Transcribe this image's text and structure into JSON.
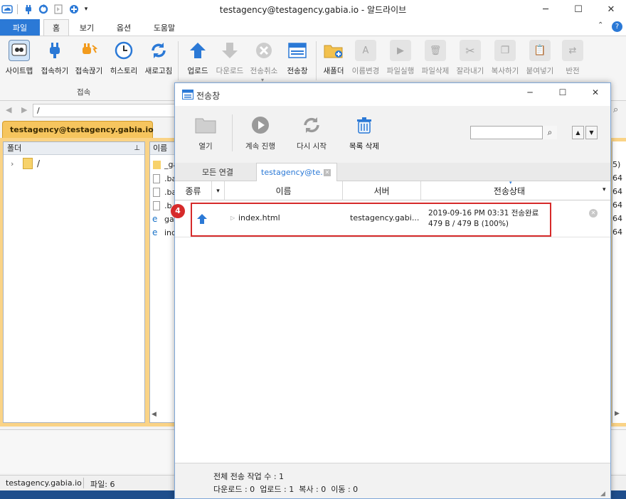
{
  "window": {
    "title": "testagency@testagency.gabia.io - 알드라이브",
    "minimize": "─",
    "maximize": "☐",
    "close": "✕"
  },
  "ribbon_tabs": [
    "파일",
    "홈",
    "보기",
    "옵션",
    "도움말"
  ],
  "ribbon": {
    "connect_group": [
      "사이트맵",
      "접속하기",
      "접속끊기",
      "히스토리",
      "새로고침"
    ],
    "connect_group_label": "접속",
    "transfer_group": [
      "업로드",
      "다운로드",
      "전송취소",
      "전송창"
    ],
    "file_group": [
      "새폴더",
      "이름변경",
      "파일실행",
      "파일삭제",
      "잘라내기",
      "복사하기",
      "붙여넣기",
      "반전"
    ]
  },
  "address": {
    "path": "/"
  },
  "session": {
    "tab": "testagency@testagency.gabia.io"
  },
  "folder_pane": {
    "header": "폴더",
    "root": "/"
  },
  "file_pane": {
    "header": "이름",
    "files": [
      "_ga",
      ".ba",
      ".ba",
      ".b",
      "ga",
      "ind"
    ],
    "right_values": [
      "5)",
      "64",
      "64",
      "64",
      "64",
      "64"
    ]
  },
  "status": {
    "host": "testagency.gabia.io",
    "files": "파일: 6"
  },
  "dialog": {
    "title": "전송창",
    "toolbar": [
      "열기",
      "계속 진행",
      "다시 시작",
      "목록 삭제"
    ],
    "tabs": [
      "모든 연결",
      "testagency@te..."
    ],
    "columns": [
      "종류",
      "이름",
      "서버",
      "전송상태"
    ],
    "row": {
      "marker": "4",
      "name": "index.html",
      "server": "testagency.gabi...",
      "datetime": "2019-09-16 PM 03:31",
      "status": "전송완료",
      "size": "479 B / 479 B (100%)"
    },
    "footer": {
      "total_label": "전체 전송 작업 수 : 1",
      "download": "다운로드 : 0",
      "upload": "업로드 : 1",
      "copy": "복사 : 0",
      "move": "이동 : 0"
    }
  }
}
